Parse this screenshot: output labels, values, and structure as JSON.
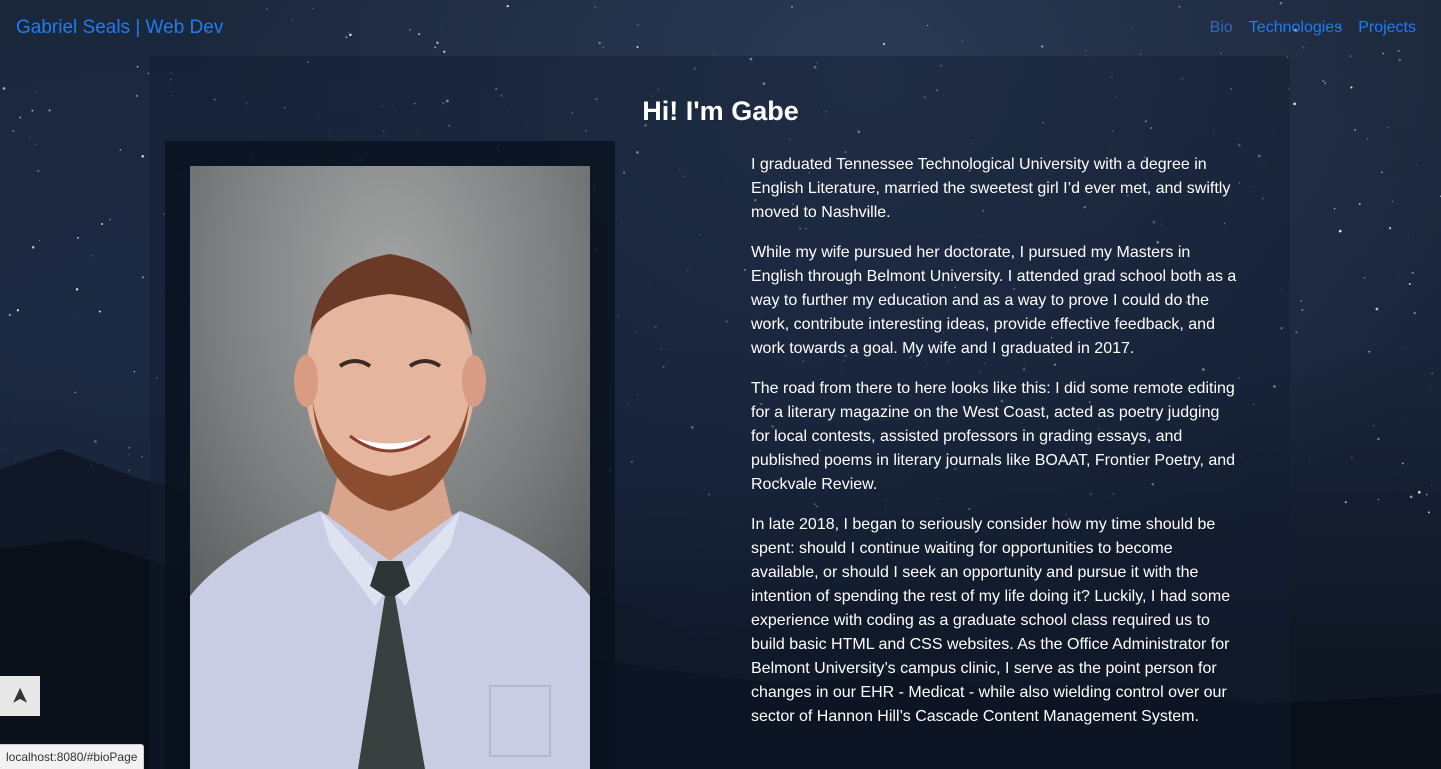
{
  "nav": {
    "brand": "Gabriel Seals | Web Dev",
    "links": [
      {
        "label": "Bio",
        "active": true
      },
      {
        "label": "Technologies",
        "active": false
      },
      {
        "label": "Projects",
        "active": false
      }
    ]
  },
  "main": {
    "title": "Hi! I'm Gabe",
    "paragraphs": [
      "I graduated Tennessee Technological University with a degree in English Literature, married the sweetest girl I’d ever met, and swiftly moved to Nashville.",
      "While my wife pursued her doctorate, I pursued my Masters in English through Belmont University. I attended grad school both as a way to further my education and as a way to prove I could do the work, contribute interesting ideas, provide effective feedback, and work towards a goal. My wife and I graduated in 2017.",
      "The road from there to here looks like this: I did some remote editing for a literary magazine on the West Coast, acted as poetry judging for local contests, assisted professors in grading essays, and published poems in literary journals like BOAAT, Frontier Poetry, and Rockvale Review.",
      "In late 2018, I began to seriously consider how my time should be spent: should I continue waiting for opportunities to become available, or should I seek an opportunity and pursue it with the intention of spending the rest of my life doing it? Luckily, I had some experience with coding as a graduate school class required us to build basic HTML and CSS websites. As the Office Administrator for Belmont University’s campus clinic, I serve as the point person for changes in our EHR - Medicat - while also wielding control over our sector of Hannon Hill’s Cascade Content Management System."
    ]
  },
  "scroll_top": {
    "icon": "arrow-up-icon",
    "glyph": "➤"
  },
  "status_bar": {
    "url": "localhost:8080/#bioPage"
  },
  "colors": {
    "link": "#1e7cf2",
    "link_active": "#2b6bb8",
    "background": "#0d1524"
  }
}
